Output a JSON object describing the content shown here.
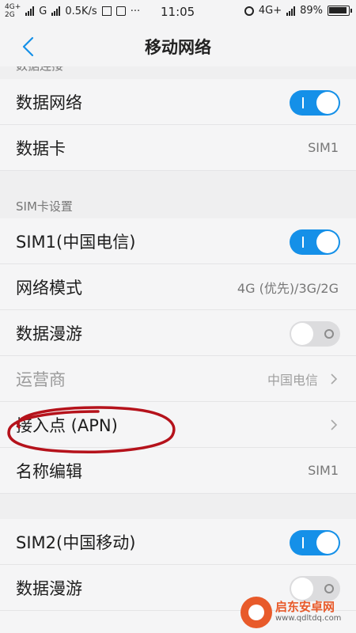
{
  "status_bar": {
    "net_top": "4G+",
    "net_bottom": "2G",
    "carrier2": "G",
    "speed": "0.5K/s",
    "dots": "···",
    "time": "11:05",
    "net_right": "4G+",
    "battery_pct": "89%"
  },
  "header": {
    "title": "移动网络",
    "back_icon": "chevron-left-icon"
  },
  "sections": {
    "data_connection_header": "数据连接",
    "data_network_label": "数据网络",
    "data_network_on": true,
    "data_card_label": "数据卡",
    "data_card_value": "SIM1",
    "sim_settings_header": "SIM卡设置",
    "sim1_label": "SIM1(中国电信)",
    "sim1_on": true,
    "network_mode_label": "网络模式",
    "network_mode_value": "4G (优先)/3G/2G",
    "roaming1_label": "数据漫游",
    "roaming1_on": false,
    "operator_label": "运营商",
    "operator_value": "中国电信",
    "apn_label": "接入点 (APN)",
    "name_edit_label": "名称编辑",
    "name_edit_value": "SIM1",
    "sim2_label": "SIM2(中国移动)",
    "sim2_on": true,
    "roaming2_label": "数据漫游",
    "roaming2_on": false
  },
  "watermark": {
    "text": "启东安卓网",
    "url": "www.qdltdq.com"
  },
  "colors": {
    "accent": "#1590e8",
    "annotation": "#b5121b",
    "background": "#efeff0"
  }
}
